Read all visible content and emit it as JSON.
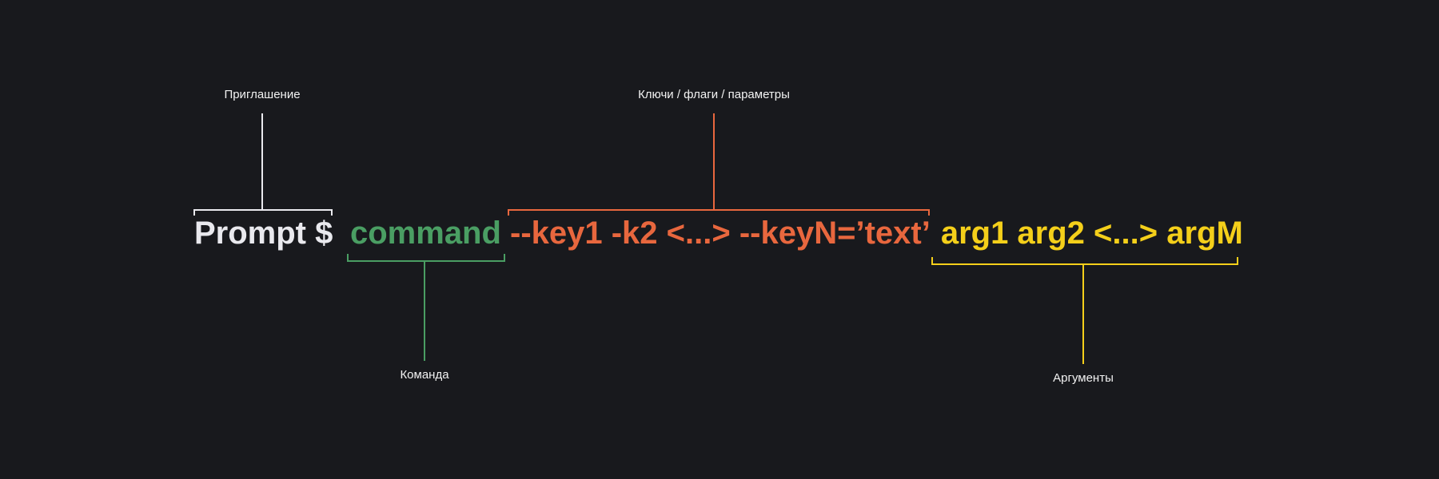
{
  "labels": {
    "prompt": "Приглашение",
    "keys": "Ключи / флаги / параметры",
    "command": "Команда",
    "args": "Аргументы"
  },
  "command_line": {
    "prompt": "Prompt $",
    "command": "command",
    "keys": "--key1 -k2 <...> --keyN=’text’",
    "args": "arg1 arg2 <...> argM"
  },
  "colors": {
    "background": "#18191d",
    "prompt": "#e9e9ee",
    "command": "#4a9e63",
    "keys": "#e8673e",
    "args": "#f4cf1a",
    "label_text": "#f2f2f2"
  }
}
